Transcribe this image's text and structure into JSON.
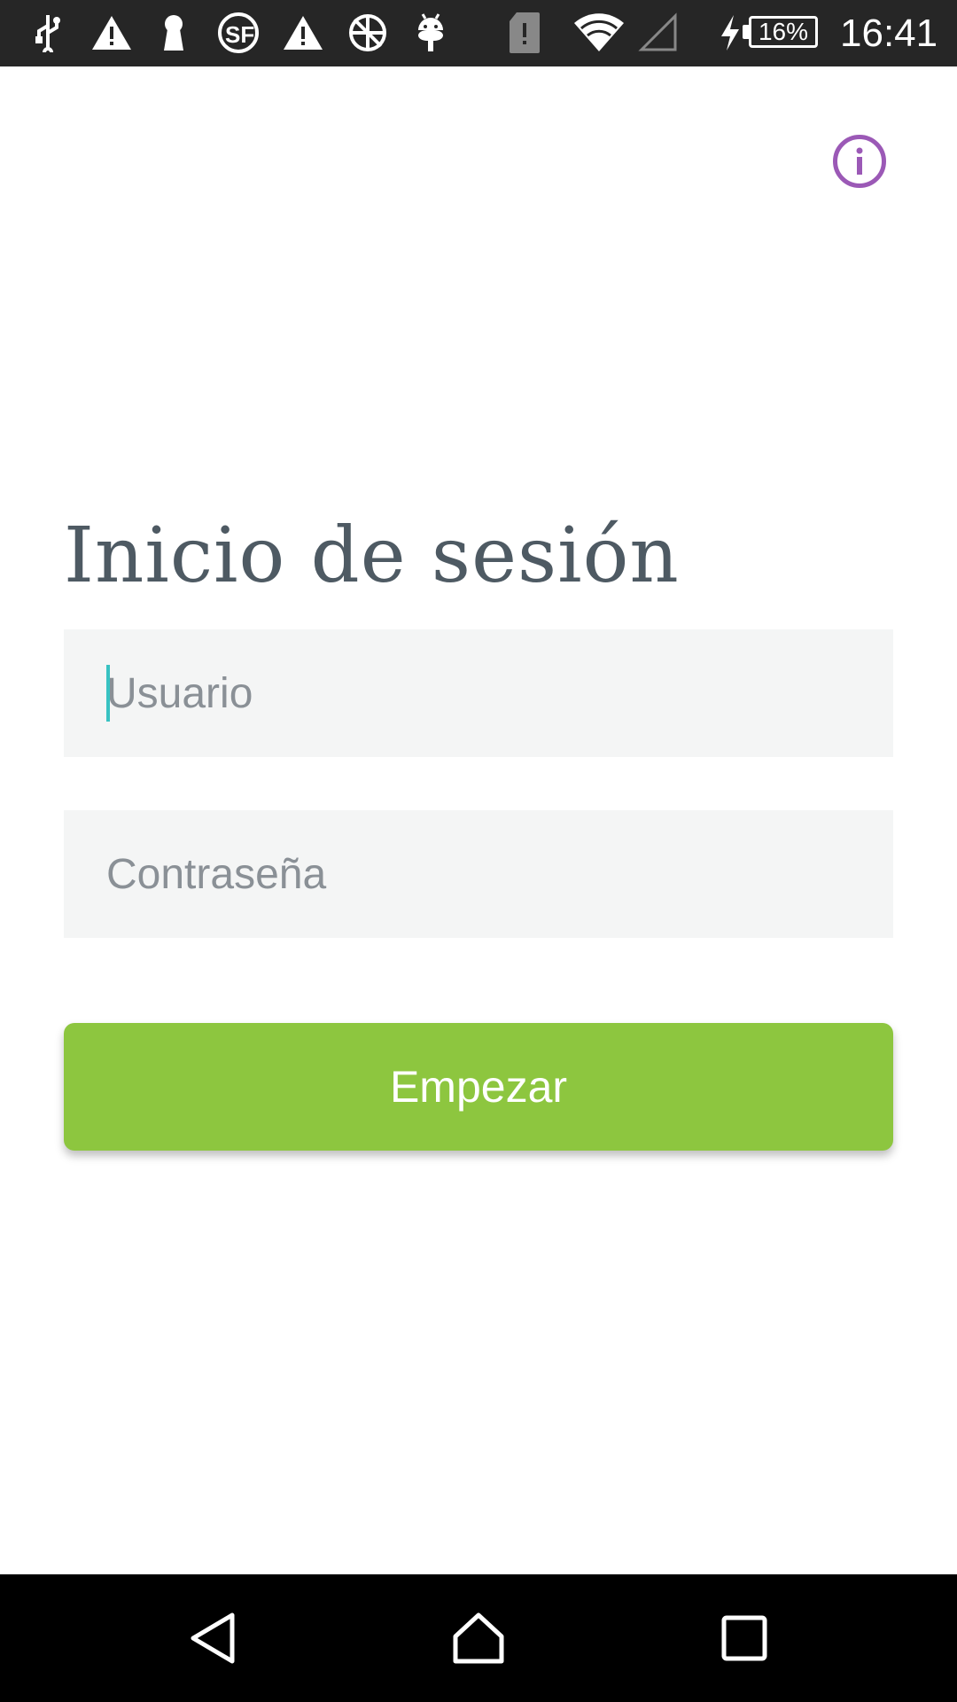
{
  "status_bar": {
    "battery_percent": "16%",
    "time": "16:41",
    "icons": [
      "usb-icon",
      "warning-icon",
      "keyhole-icon",
      "sf-icon",
      "warning-icon",
      "no-network-icon",
      "android-icon",
      "sim-alert-icon",
      "wifi-icon",
      "signal-icon",
      "charging-icon",
      "battery-icon"
    ]
  },
  "header": {
    "info_icon": "info-icon"
  },
  "login": {
    "title": "Inicio de sesión",
    "username": {
      "value": "",
      "placeholder": "Usuario"
    },
    "password": {
      "value": "",
      "placeholder": "Contraseña"
    },
    "submit_label": "Empezar"
  },
  "colors": {
    "accent_purple": "#9b59b6",
    "button_green": "#8dc63f",
    "title_text": "#4e5a63",
    "field_bg": "#f4f5f5",
    "cursor": "#38c2c2"
  },
  "nav_bar": {
    "buttons": [
      "back-icon",
      "home-icon",
      "recents-icon"
    ]
  }
}
